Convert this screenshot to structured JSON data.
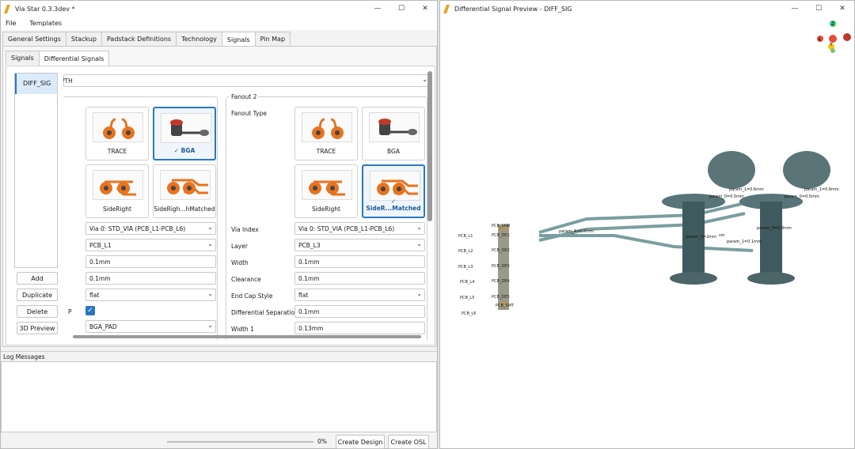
{
  "app": {
    "title": "Via Star 0.3.3dev *",
    "menu": [
      "File",
      "Templates"
    ],
    "tabs": [
      "General Settings",
      "Stackup",
      "Padstack Definitions",
      "Technology",
      "Signals",
      "Pin Map"
    ],
    "subtabs": [
      "Signals",
      "Differential Signals"
    ],
    "signal_list": [
      "DIFF_SIG"
    ],
    "buttons": {
      "add": "Add",
      "duplicate": "Duplicate",
      "delete": "Delete",
      "preview": "3D Preview"
    },
    "top_field": "PTH",
    "left": {
      "cards": [
        "TRACE",
        "✓ BGA",
        "SideRight",
        "SideRigh...hMatched"
      ],
      "via": "Via 0: STD_VIA (PCB_L1-PCB_L6)",
      "layer": "PCB_L1",
      "width": "0.1mm",
      "clearance": "0.1mm",
      "endcap": "flat",
      "p_label": "P",
      "pad": "BGA_PAD"
    },
    "fanout2": {
      "title": "Fanout 2",
      "type_label": "Fanout Type",
      "cards": [
        "TRACE",
        "BGA",
        "SideRight",
        "✓ SideR...Matched"
      ],
      "labels": [
        "Via Index",
        "Layer",
        "Width",
        "Clearance",
        "End Cap Style",
        "Differential Separation",
        "Width 1"
      ],
      "values": [
        "Via 0: STD_VIA (PCB_L1-PCB_L6)",
        "PCB_L3",
        "0.1mm",
        "0.1mm",
        "flat",
        "0.1mm",
        "0.13mm"
      ]
    },
    "log_title": "Log Messages",
    "progress": "0%",
    "create_design": "Create Design",
    "create_osl": "Create OSL"
  },
  "preview": {
    "title": "Differential Signal Preview - DIFF_SIG",
    "layers": [
      "PCB_SMB",
      "PCB_L1",
      "PCB_DE1",
      "PCB_L2",
      "PCB_DE2",
      "PCB_L3",
      "PCB_DE3",
      "PCB_L4",
      "PCB_DE4",
      "PCB_L5",
      "PCB_DE5",
      "PCB_SMT",
      "PCB_L6"
    ],
    "params": [
      "param_1=0.6mm",
      "param_0=0.5mm",
      "param_1=0.6mm",
      "param_0=0.5mm",
      "param_4=0.5mm",
      "param_0=0.3mm",
      "param_3=2mm",
      "sm",
      "param_1=0.1mm"
    ],
    "axes": [
      "Z",
      "X",
      "Y"
    ]
  },
  "colors": {
    "accent": "#2a78c2",
    "pad": "#e8731f",
    "via": "#3f5a5e",
    "logo": "#e8a317"
  }
}
